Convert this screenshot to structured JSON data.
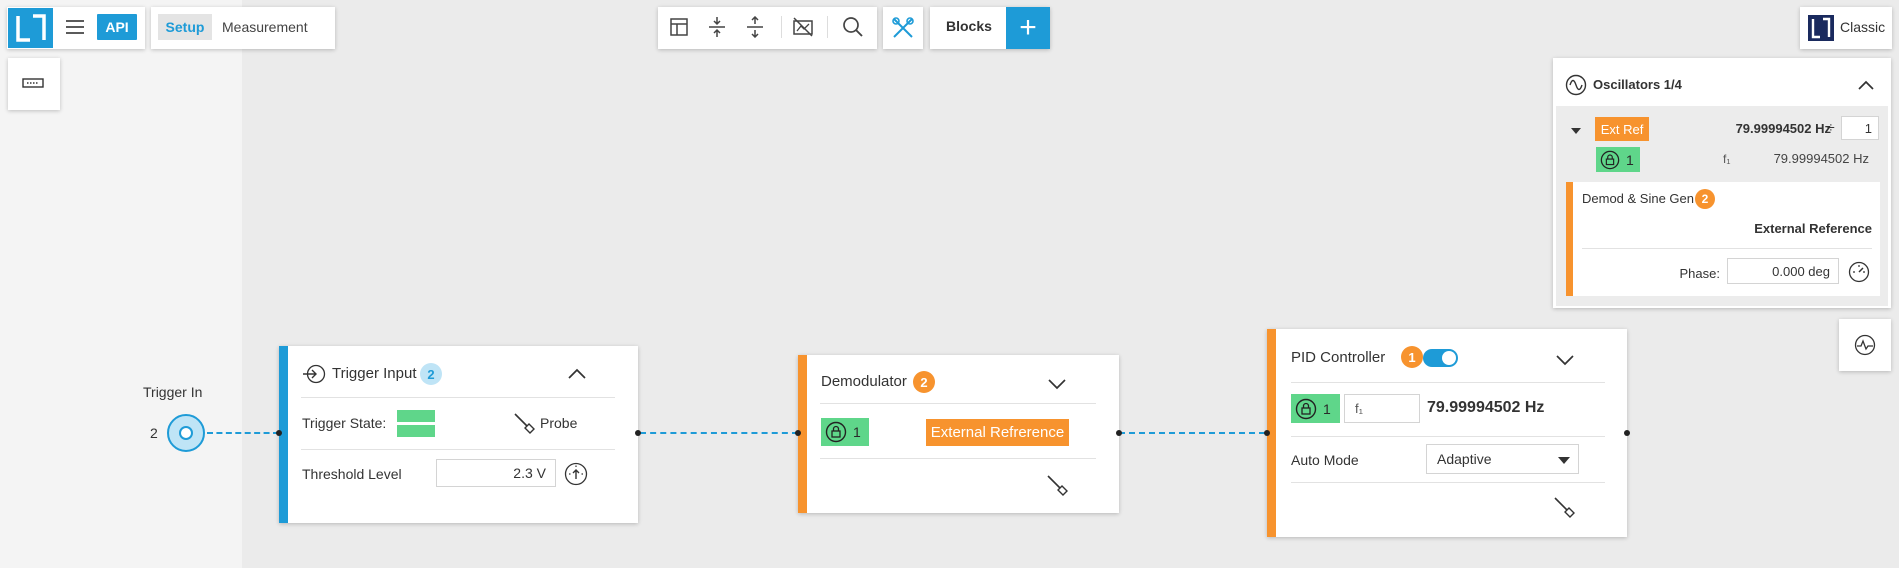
{
  "header": {
    "api_label": "API",
    "tabs": [
      {
        "label": "Setup"
      },
      {
        "label": "Measurement"
      }
    ]
  },
  "toolbar": {
    "blocks_label": "Blocks",
    "add_label": "+",
    "icons": [
      "layout-icon",
      "collapse-vertical-icon",
      "expand-vertical-icon",
      "hide-graph-icon",
      "search-icon",
      "tools-icon"
    ]
  },
  "classic": {
    "label": "Classic"
  },
  "trigger_in": {
    "label": "Trigger In",
    "number": "2"
  },
  "trigger_input_block": {
    "title": "Trigger Input",
    "badge": "2",
    "state_label": "Trigger State:",
    "probe_label": "Probe",
    "threshold_label": "Threshold Level",
    "threshold_value": "2.3 V"
  },
  "demodulator_block": {
    "title": "Demodulator",
    "badge": "2",
    "lock_value": "1",
    "reference_label": "External Refrerence"
  },
  "pid_block": {
    "title": "PID Controller",
    "badge": "1",
    "enabled": true,
    "lock_value": "1",
    "freq_symbol": "f₁",
    "freq_value": "79.99994502 Hz",
    "auto_mode_label": "Auto Mode",
    "auto_mode_value": "Adaptive"
  },
  "oscillators": {
    "title": "Oscillators 1/4",
    "ext_ref_label": "Ext Ref",
    "frequency": "79.99994502 Hz",
    "divide_symbol": "÷",
    "divider_value": "1",
    "lock_value": "1",
    "f1_label": "f₁",
    "f1_value": "79.99994502 Hz",
    "demod": {
      "title": "Demod & Sine Gen",
      "badge": "2",
      "source": "External Reference",
      "phase_label": "Phase:",
      "phase_value": "0.000 deg"
    }
  },
  "colors": {
    "accent_blue": "#1e9bd7",
    "orange": "#f7932e",
    "lock_green": "#5fd68a",
    "badge_light_blue": "#bfe4f6",
    "canvas_bg": "#ebebeb"
  }
}
